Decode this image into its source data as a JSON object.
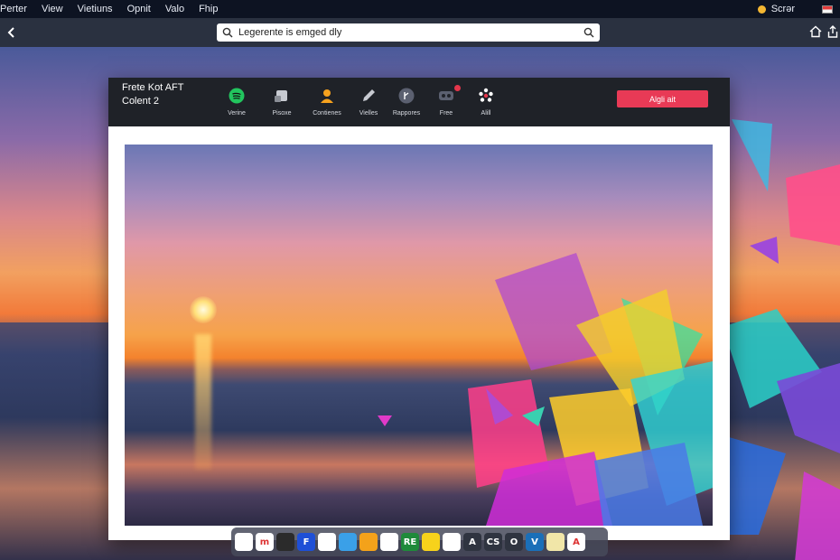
{
  "menubar": {
    "items": [
      "Perter",
      "View",
      "Vietiuns",
      "Opnit",
      "Valo",
      "Fhip"
    ],
    "right_user": "Scrər"
  },
  "toolbar": {
    "address_value": "Legerente is emged dly"
  },
  "app": {
    "title": "Frete Kot AFT",
    "subtitle": "Colent 2",
    "tools": [
      {
        "label": "Verine",
        "icon": "spotify-icon"
      },
      {
        "label": "Pisoxe",
        "icon": "square-icon"
      },
      {
        "label": "Contienes",
        "icon": "user-icon"
      },
      {
        "label": "Vielles",
        "icon": "pen-icon"
      },
      {
        "label": "Rappores",
        "icon": "share-icon"
      },
      {
        "label": "Free",
        "icon": "vr-icon"
      },
      {
        "label": "Alill",
        "icon": "dots-icon"
      }
    ],
    "primary_button": "Algli ait"
  },
  "dock": {
    "icons": [
      {
        "name": "chrome",
        "glyph": "",
        "color": "#ffffff"
      },
      {
        "name": "mail",
        "glyph": "m",
        "color": "#ffffff"
      },
      {
        "name": "finder",
        "glyph": "",
        "color": "#2b2b2b"
      },
      {
        "name": "files",
        "glyph": "F",
        "color": "#1e4fd6"
      },
      {
        "name": "drive",
        "glyph": "",
        "color": "#ffffff"
      },
      {
        "name": "notes",
        "glyph": "",
        "color": "#3aa0e8"
      },
      {
        "name": "store",
        "glyph": "",
        "color": "#f4a21a"
      },
      {
        "name": "photos",
        "glyph": "",
        "color": "#ffffff"
      },
      {
        "name": "terminal",
        "glyph": "RE",
        "color": "#1f8a3a"
      },
      {
        "name": "pencil",
        "glyph": "",
        "color": "#f7d21b"
      },
      {
        "name": "chrome-2",
        "glyph": "",
        "color": "#ffffff"
      },
      {
        "name": "app-a",
        "glyph": "A",
        "color": "#2f3440"
      },
      {
        "name": "app-cs",
        "glyph": "CS",
        "color": "#2f3440"
      },
      {
        "name": "app-o",
        "glyph": "O",
        "color": "#2f3440"
      },
      {
        "name": "app-v",
        "glyph": "V",
        "color": "#1a6fb8"
      },
      {
        "name": "app-notes",
        "glyph": "",
        "color": "#f1e6a8"
      },
      {
        "name": "app-triangle",
        "glyph": "A",
        "color": "#ffffff"
      }
    ]
  },
  "colors": {
    "primary": "#e83a56",
    "header": "#1f2228",
    "menubar": "#0d1322"
  }
}
